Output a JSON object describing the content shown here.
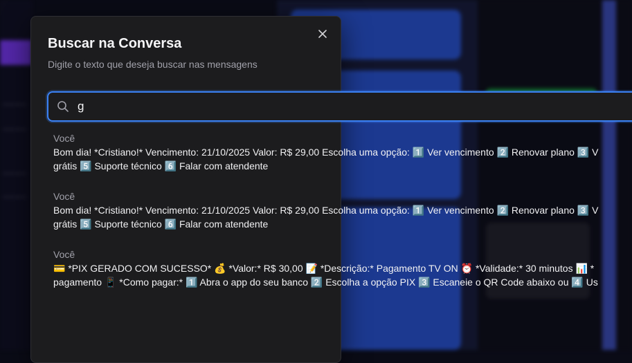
{
  "modal": {
    "title": "Buscar na Conversa",
    "subtitle": "Digite o texto que deseja buscar nas mensagens"
  },
  "search": {
    "value": "g"
  },
  "results": [
    {
      "sender": "Você",
      "line1": "Bom dia! *Cristiano!* Vencimento: 21/10/2025 Valor: R$ 29,00 Escolha uma opção: 1️⃣ Ver vencimento 2️⃣ Renovar plano 3️⃣ V",
      "line2": "grátis 5️⃣ Suporte técnico 6️⃣ Falar com atendente"
    },
    {
      "sender": "Você",
      "line1": "Bom dia! *Cristiano!* Vencimento: 21/10/2025 Valor: R$ 29,00 Escolha uma opção: 1️⃣ Ver vencimento 2️⃣ Renovar plano 3️⃣ V",
      "line2": "grátis 5️⃣ Suporte técnico 6️⃣ Falar com atendente"
    },
    {
      "sender": "Você",
      "line1": "💳 *PIX GERADO COM SUCESSO* 💰 *Valor:* R$ 30,00 📝 *Descrição:* Pagamento TV ON ⏰ *Validade:* 30 minutos 📊 *",
      "line2": "pagamento 📱 *Como pagar:* 1️⃣ Abra o app do seu banco 2️⃣ Escolha a opção PIX 3️⃣ Escaneie o QR Code abaixo ou 4️⃣ Us"
    }
  ]
}
